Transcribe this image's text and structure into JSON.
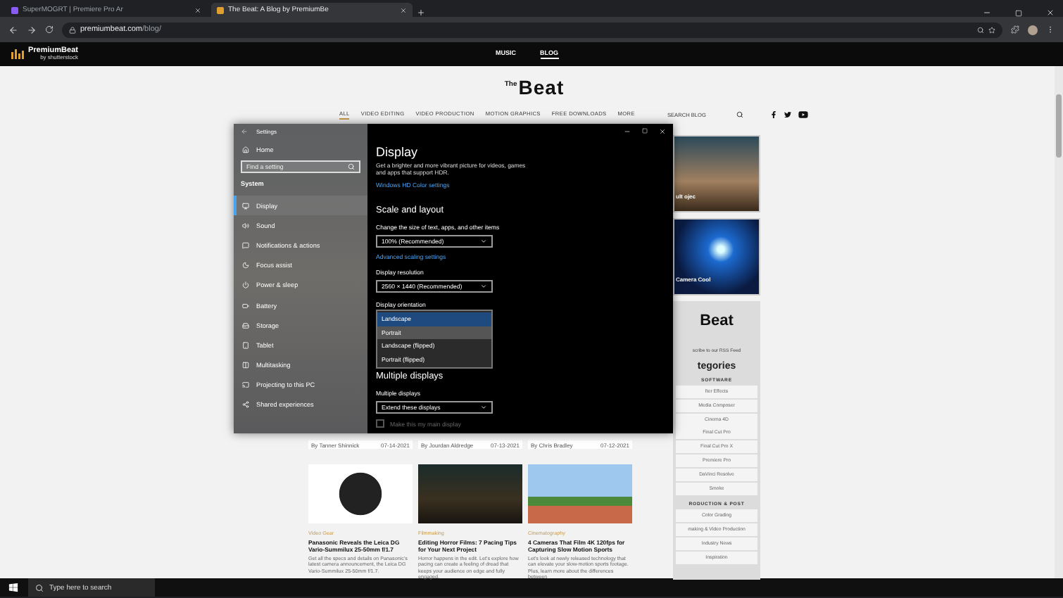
{
  "browser": {
    "tabs": [
      {
        "title": "SuperMOGRT | Premiere Pro Ar",
        "selected": false
      },
      {
        "title": "The Beat: A Blog by PremiumBe",
        "selected": true
      }
    ],
    "address": {
      "host": "premiumbeat.com",
      "path": "/blog/"
    }
  },
  "site_header": {
    "logo_name": "PremiumBeat",
    "logo_sub": "by shutterstock",
    "nav": [
      {
        "label": "MUSIC",
        "selected": false
      },
      {
        "label": "BLOG",
        "selected": true
      }
    ]
  },
  "blog": {
    "logo_small": "The",
    "logo_big": "Beat",
    "categories": [
      {
        "label": "ALL",
        "selected": true
      },
      {
        "label": "VIDEO EDITING",
        "selected": false
      },
      {
        "label": "VIDEO PRODUCTION",
        "selected": false
      },
      {
        "label": "MOTION GRAPHICS",
        "selected": false
      },
      {
        "label": "FREE DOWNLOADS",
        "selected": false
      },
      {
        "label": "MORE",
        "selected": false
      }
    ],
    "search": {
      "placeholder": "SEARCH BLOG"
    }
  },
  "settings": {
    "title": "Settings",
    "home": "Home",
    "search": {
      "placeholder": "Find a setting"
    },
    "section": "System",
    "nav": [
      {
        "label": "Display",
        "selected": true
      },
      {
        "label": "Sound",
        "selected": false
      },
      {
        "label": "Notifications & actions",
        "selected": false
      },
      {
        "label": "Focus assist",
        "selected": false
      },
      {
        "label": "Power & sleep",
        "selected": false
      },
      {
        "label": "Battery",
        "selected": false
      },
      {
        "label": "Storage",
        "selected": false
      },
      {
        "label": "Tablet",
        "selected": false
      },
      {
        "label": "Multitasking",
        "selected": false
      },
      {
        "label": "Projecting to this PC",
        "selected": false
      },
      {
        "label": "Shared experiences",
        "selected": false
      }
    ],
    "heading": "Display",
    "description": "Get a brighter and more vibrant picture for videos, games and apps that support HDR.",
    "hdr_link": "Windows HD Color settings",
    "scale_heading": "Scale and layout",
    "scale_label": "Change the size of text, apps, and other items",
    "scale_value": "100% (Recommended)",
    "scaling_link": "Advanced scaling settings",
    "resolution_label": "Display resolution",
    "resolution_value": "2560 × 1440 (Recommended)",
    "orientation_label": "Display orientation",
    "orientation_options": [
      {
        "label": "Landscape",
        "selected": true,
        "hovered": false
      },
      {
        "label": "Portrait",
        "selected": false,
        "hovered": true
      },
      {
        "label": "Landscape (flipped)",
        "selected": false,
        "hovered": false
      },
      {
        "label": "Portrait (flipped)",
        "selected": false,
        "hovered": false
      }
    ],
    "multi_heading": "Multiple displays",
    "multi_label": "Multiple displays",
    "multi_value": "Extend these displays",
    "main_display": {
      "label": "Make this my main display",
      "checked": false,
      "disabled": true
    }
  },
  "posts": [
    {
      "author": "By Tanner Shinnick",
      "date": "07-14-2021",
      "category": "Video Gear",
      "title": "Panasonic Reveals the Leica DG Vario-Summilux 25-50mm f/1.7",
      "excerpt": "Get all the specs and details on Panasonic's latest camera announcement, the Leica DG Vario-Summilux 25-50mm f/1.7."
    },
    {
      "author": "By Jourdan Aldredge",
      "date": "07-13-2021",
      "category": "Filmmaking",
      "title": "Editing Horror Films: 7 Pacing Tips for Your Next Project",
      "excerpt": "Horror happens in the edit. Let's explore how pacing can create a feeling of dread that keeps your audience on edge and fully engaged."
    },
    {
      "author": "By Chris Bradley",
      "date": "07-12-2021",
      "category": "Cinematography",
      "title": "4 Cameras That Film 4K 120fps for Capturing Slow Motion Sports",
      "excerpt": "Let's look at newly released technology that can elevate your slow-motion sports footage. Plus, learn more about the differences between"
    }
  ],
  "sidebar": {
    "featured": [
      {
        "caption": "ult ojec"
      },
      {
        "caption": "Camera Cool"
      }
    ],
    "brand": "Beat",
    "rss": "scribe to our RSS Feed",
    "heading": "tegories",
    "groups": [
      {
        "title": "SOFTWARE",
        "items": [
          "fter Effects",
          "Media Composer",
          "Cinema 4D",
          "Final Cut Pro",
          "Final Cut Pro X",
          "Premiere Pro",
          "DaVinci Resolve",
          "Smoke"
        ]
      },
      {
        "title": "RODUCTION & POST",
        "items": [
          "Color Grading",
          "making & Video Production",
          "Industry News",
          "Inspiration"
        ]
      }
    ]
  },
  "taskbar": {
    "search": {
      "placeholder": "Type here to search"
    }
  }
}
